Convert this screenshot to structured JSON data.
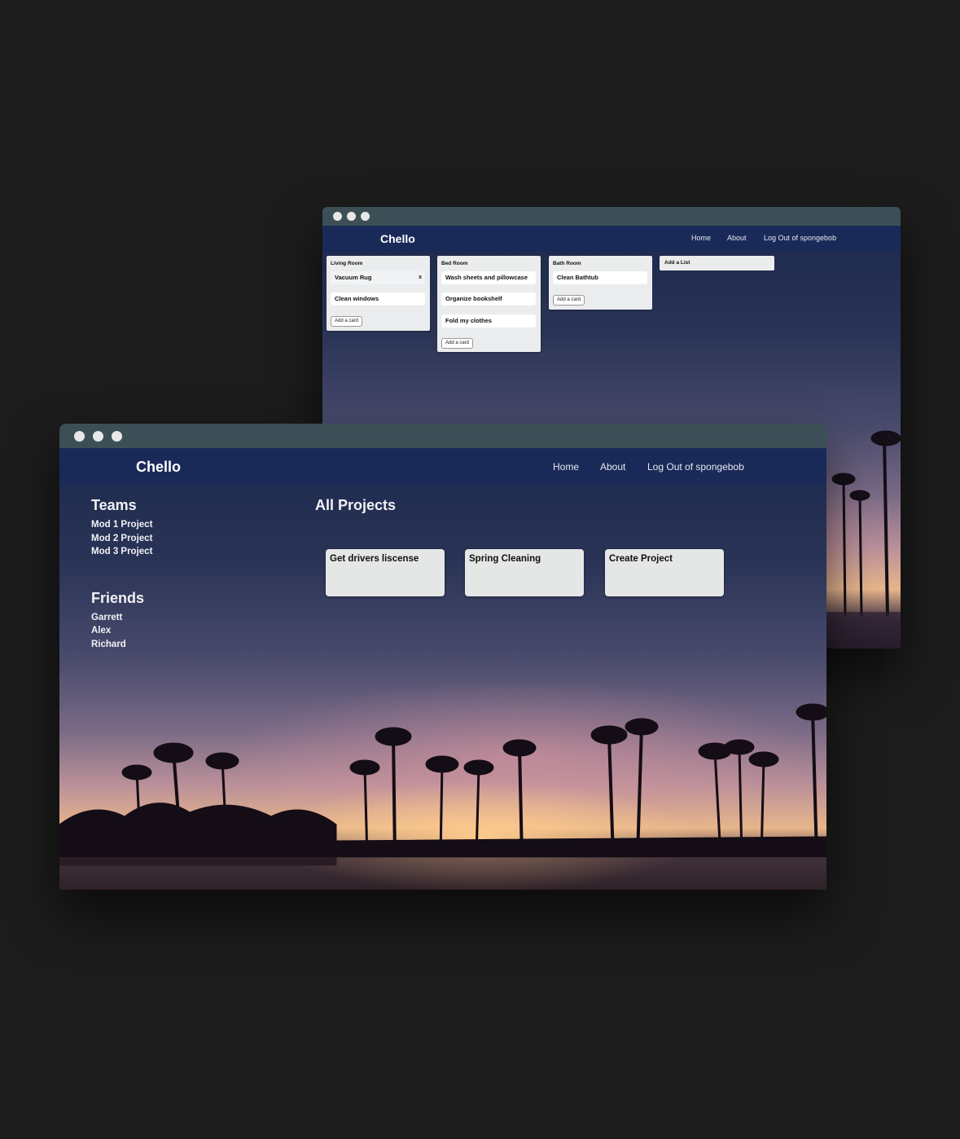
{
  "brand": "Chello",
  "nav": {
    "home": "Home",
    "about": "About",
    "logout": "Log Out of spongebob"
  },
  "board": {
    "lists": [
      {
        "title": "Living Room",
        "cards": [
          {
            "text": "Vacuum Rug",
            "close": "x"
          },
          {
            "text": "Clean windows"
          }
        ],
        "add_card": "Add a card"
      },
      {
        "title": "Bed Room",
        "cards": [
          {
            "text": "Wash sheets and pillowcase"
          },
          {
            "text": "Organize bookshelf"
          },
          {
            "text": "Fold my clothes"
          }
        ],
        "add_card": "Add a card"
      },
      {
        "title": "Bath Room",
        "cards": [
          {
            "text": "Clean Bathtub"
          }
        ],
        "add_card": "Add a card"
      }
    ],
    "add_list": "Add a List"
  },
  "dashboard": {
    "teams": {
      "heading": "Teams",
      "items": [
        "Mod 1 Project",
        "Mod 2 Project",
        "Mod 3 Project"
      ]
    },
    "friends": {
      "heading": "Friends",
      "items": [
        "Garrett",
        "Alex",
        "Richard"
      ]
    },
    "projects": {
      "heading": "All Projects",
      "items": [
        "Get drivers liscense",
        "Spring Cleaning",
        "Create Project"
      ]
    }
  }
}
